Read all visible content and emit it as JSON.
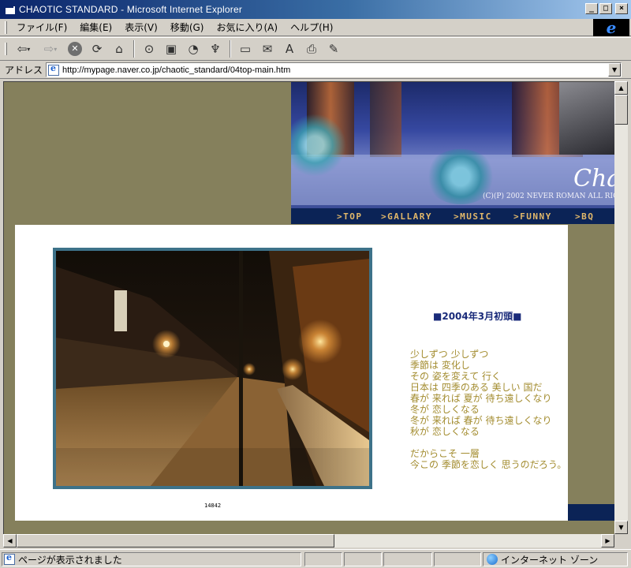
{
  "window": {
    "title": "CHAOTIC STANDARD - Microsoft Internet Explorer",
    "buttons": {
      "minimize": "_",
      "maximize": "□",
      "close": "×"
    }
  },
  "menu": {
    "items": [
      "ファイル(F)",
      "編集(E)",
      "表示(V)",
      "移動(G)",
      "お気に入り(A)",
      "ヘルプ(H)"
    ]
  },
  "toolbar": {
    "icons": [
      "back-icon",
      "forward-icon",
      "stop-icon",
      "refresh-icon",
      "home-icon",
      "search-icon",
      "favorites-icon",
      "history-icon",
      "channels-icon",
      "fullscreen-icon",
      "mail-icon",
      "font-icon",
      "print-icon",
      "edit-icon"
    ]
  },
  "address": {
    "label": "アドレス",
    "url": "http://mypage.naver.co.jp/chaotic_standard/04top-main.htm"
  },
  "banner": {
    "logo": "Cha",
    "copyright": "(C)(P) 2002 NEVER ROMAN ALL RIG"
  },
  "nav": {
    "items": [
      ">TOP",
      ">GALLARY",
      ">MUSIC",
      ">FUNNY",
      ">BQ"
    ]
  },
  "content": {
    "counter": "14842",
    "poem_title": "■2004年3月初頭■",
    "poem_lines": [
      "少しずつ 少しずつ",
      "季節は 変化し",
      "その 姿を変えて 行く",
      "日本は 四季のある 美しい 国だ",
      "春が 来れば 夏が 待ち遠しくなり",
      "冬が 恋しくなる",
      "冬が 来れば 春が 待ち遠しくなり",
      "秋が 恋しくなる"
    ],
    "poem_lines2": [
      "だからこそ 一層",
      "今この 季節を恋しく 思うのだろう。"
    ]
  },
  "status": {
    "text": "ページが表示されました",
    "zone": "インターネット ゾーン"
  },
  "colors": {
    "page_bg": "#85805c",
    "nav_bg": "#0b2356",
    "nav_text": "#e2b86a",
    "poem_title": "#1a2b7a",
    "poem_text": "#a38c2f",
    "photo_frame": "#3d7289"
  }
}
